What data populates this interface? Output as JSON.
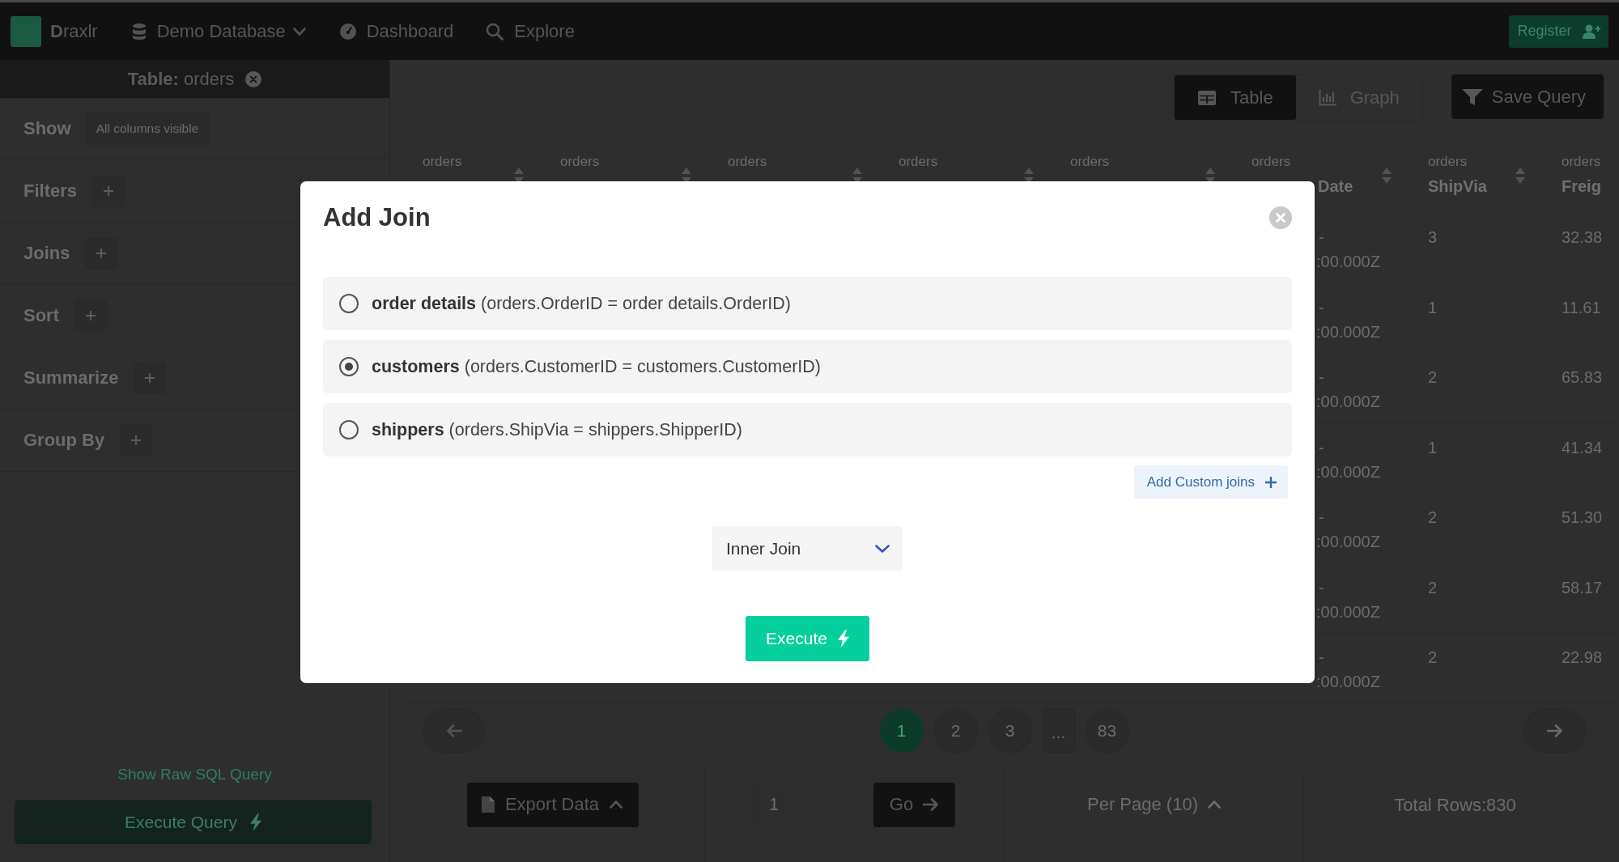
{
  "topbar": {
    "logo": "**D**raxlr",
    "database_menu": "Demo Database",
    "dashboard_link": "Dashboard",
    "explore_link": "Explore",
    "register_button": "Register"
  },
  "sidebar": {
    "table_label": "**Table:** orders",
    "show": {
      "label": "Show",
      "value": "All columns visible"
    },
    "sections": [
      {
        "label": "Filters"
      },
      {
        "label": "Joins"
      },
      {
        "label": "Sort"
      },
      {
        "label": "Summarize"
      },
      {
        "label": "Group By"
      }
    ],
    "raw_sql_link": "Show Raw SQL Query",
    "execute_button": "Execute Query"
  },
  "toolbar": {
    "view_tabs": [
      {
        "label": "Table",
        "selected": true
      },
      {
        "label": "Graph",
        "selected": false
      }
    ],
    "save_query_button": "Save Query"
  },
  "table": {
    "columns": [
      {
        "group": "orders"
      },
      {
        "group": "orders"
      },
      {
        "group": "orders"
      },
      {
        "group": "orders"
      },
      {
        "group": "orders"
      },
      {
        "group": "orders",
        "name": "Date"
      },
      {
        "group": "orders",
        "name": "ShipVia"
      },
      {
        "group": "orders",
        "name": "Freig"
      }
    ],
    "rows": [
      {
        "column_6": [
          "-",
          ":00.000Z"
        ],
        "ship_via": "3",
        "column_8": "32.38"
      },
      {
        "column_6": [
          "-",
          ":00.000Z"
        ],
        "ship_via": "1",
        "column_8": "11.61"
      },
      {
        "column_6": [
          "-",
          ":00.000Z"
        ],
        "ship_via": "2",
        "column_8": "65.83"
      },
      {
        "column_6": [
          "-",
          ":00.000Z"
        ],
        "ship_via": "1",
        "column_8": "41.34"
      },
      {
        "column_6": [
          "-",
          ":00.000Z"
        ],
        "ship_via": "2",
        "column_8": "51.30"
      },
      {
        "column_6": [
          "-",
          ":00.000Z"
        ],
        "ship_via": "2",
        "column_8": "58.17"
      },
      {
        "column_6": [
          "-",
          ":00.000Z"
        ],
        "ship_via": "2",
        "column_8": "22.98"
      }
    ]
  },
  "pagination": {
    "pages": [
      {
        "label": "1",
        "kind": "page",
        "selected": true
      },
      {
        "label": "2",
        "kind": "page",
        "selected": false
      },
      {
        "label": "3",
        "kind": "page",
        "selected": false
      },
      {
        "label": "...",
        "kind": "ellipsis",
        "selected": false
      },
      {
        "label": "83",
        "kind": "page",
        "selected": false
      }
    ]
  },
  "footer": {
    "export_button": "Export Data",
    "page_input": {
      "value": "1"
    },
    "go_button": "Go",
    "per_page_button": "Per Page (10)",
    "total_rows": "Total Rows:830"
  },
  "modal": {
    "title": "Add Join",
    "options": [
      {
        "label": "**order details** (orders.OrderID = order details.OrderID)",
        "selected": false
      },
      {
        "label": "**customers** (orders.CustomerID = customers.CustomerID)",
        "selected": true
      },
      {
        "label": "**shippers** (orders.ShipVia = shippers.ShipperID)",
        "selected": false
      }
    ],
    "custom_joins_button": "Add Custom joins",
    "join_type": "Inner Join",
    "execute_button": "Execute"
  }
}
